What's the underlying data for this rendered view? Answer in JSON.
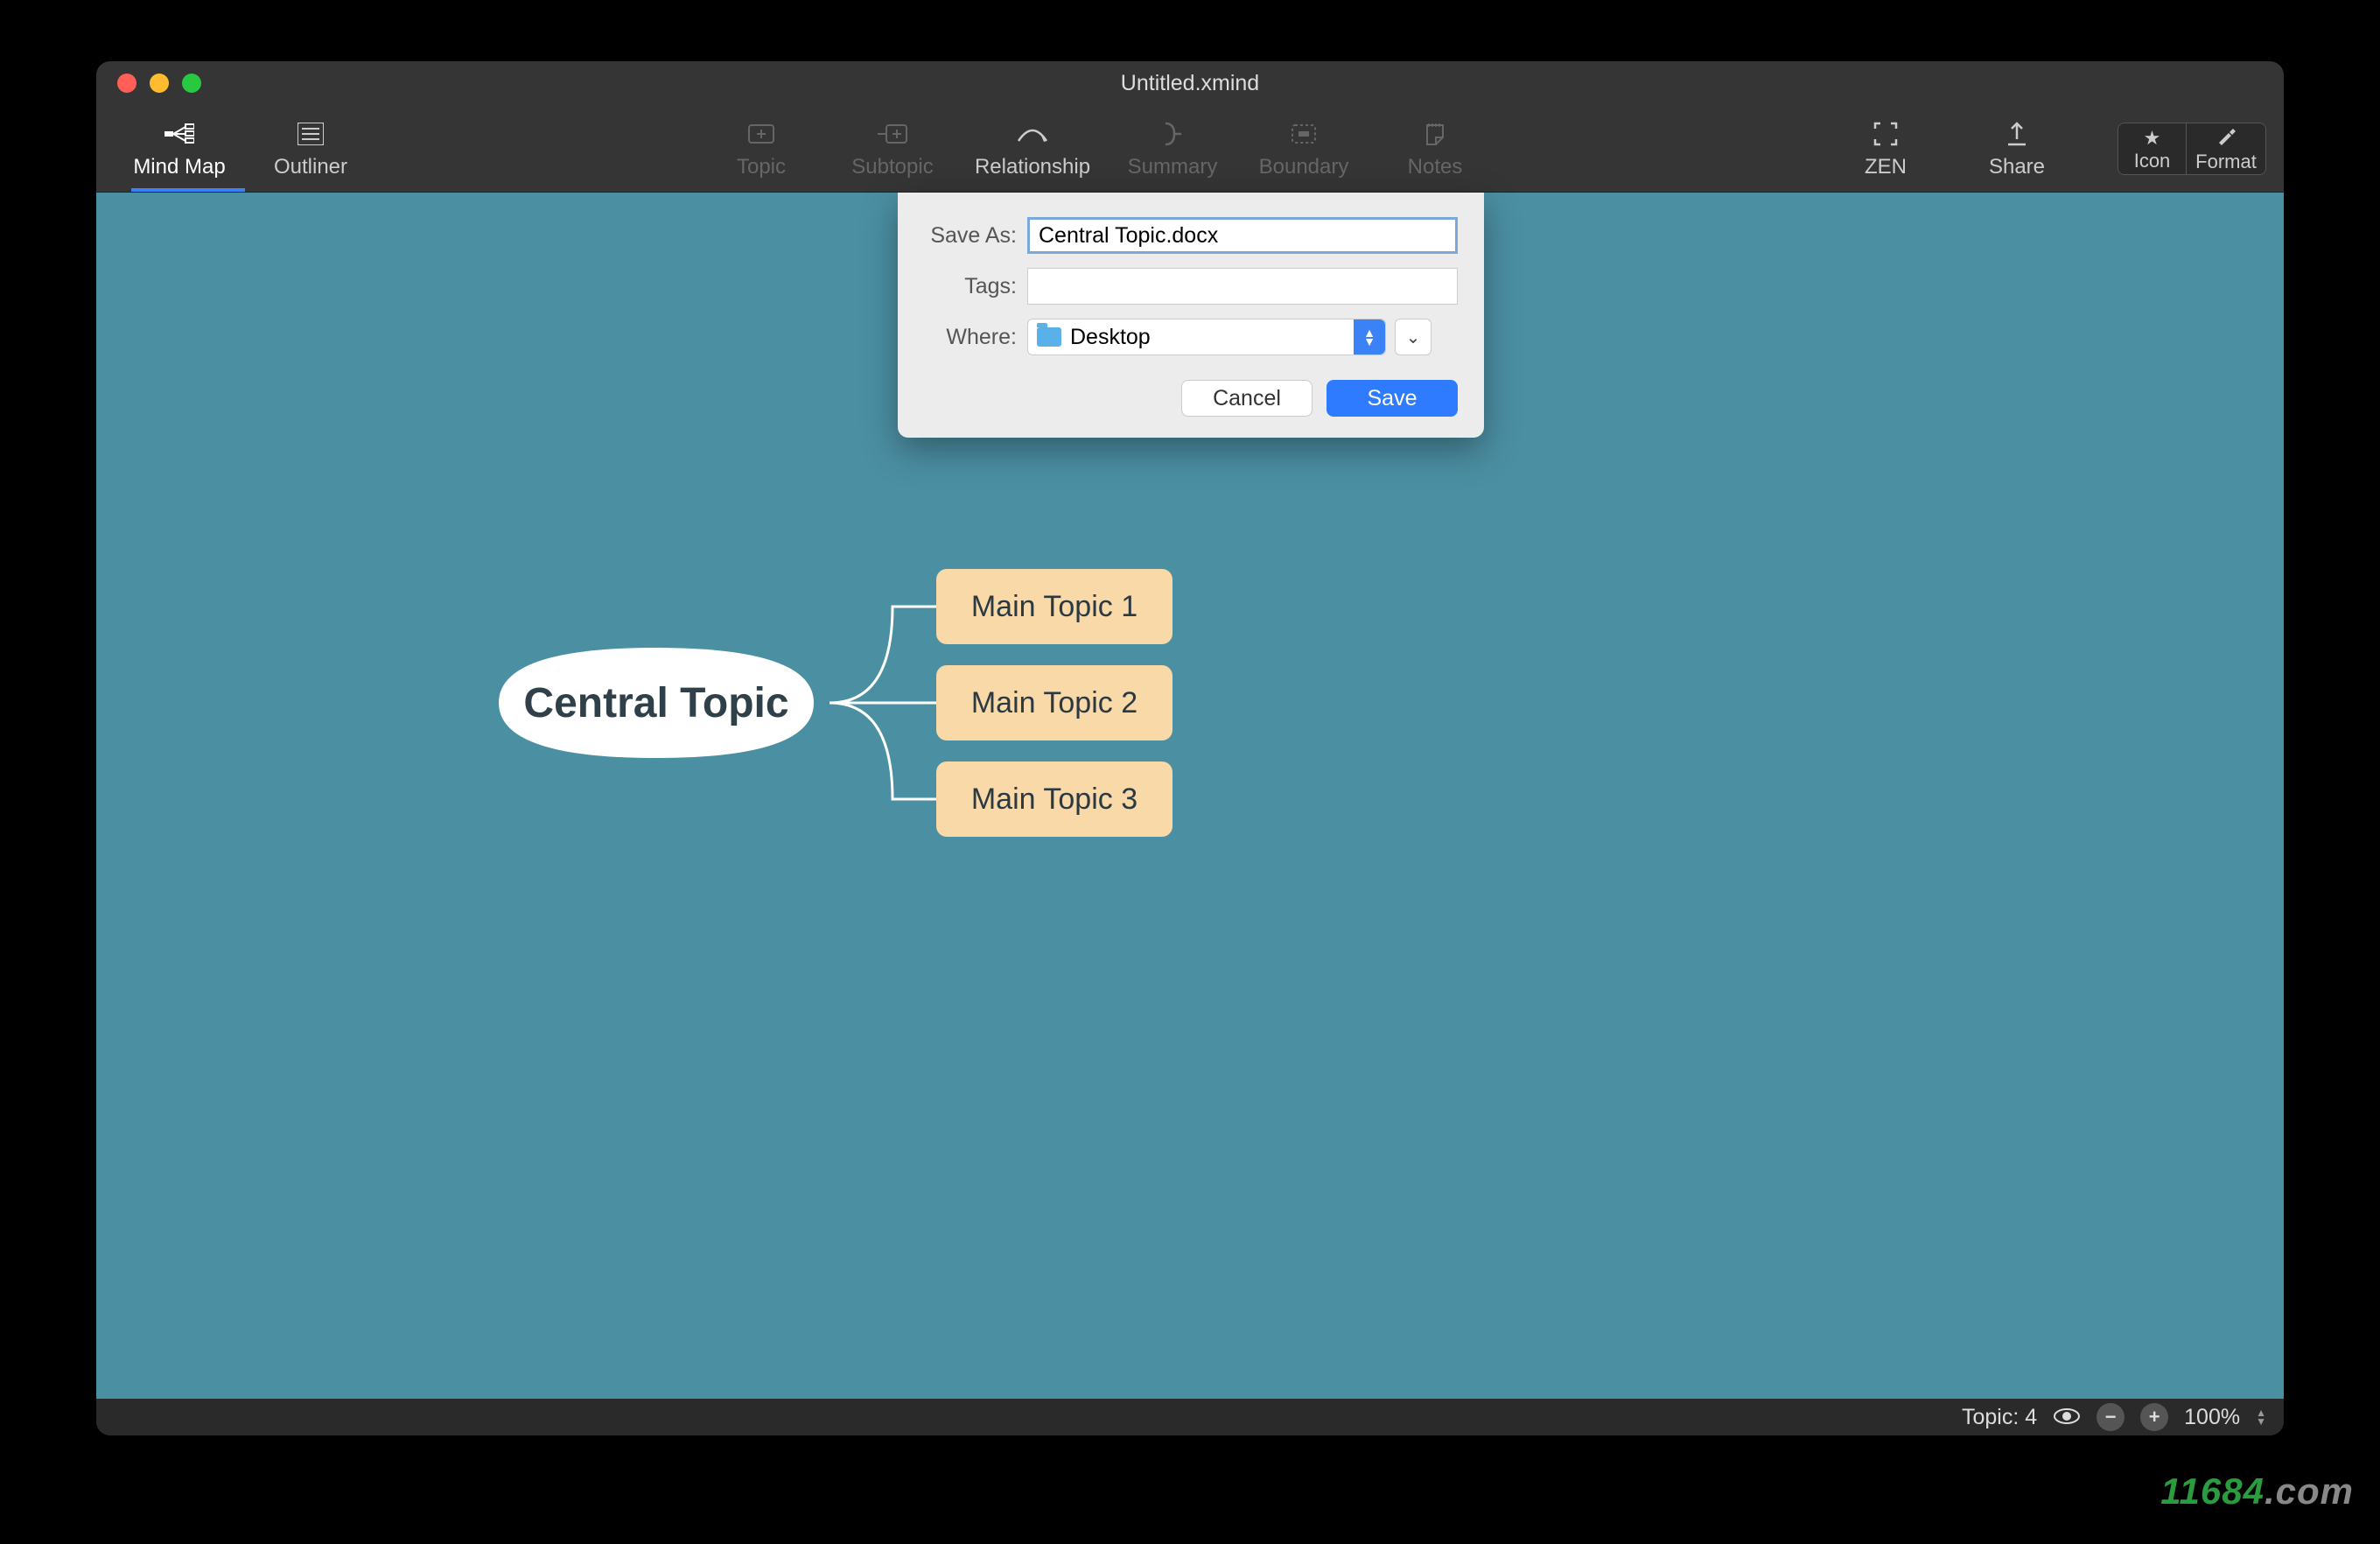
{
  "window": {
    "title": "Untitled.xmind"
  },
  "toolbar": {
    "left_tabs": [
      {
        "label": "Mind Map",
        "active": true
      },
      {
        "label": "Outliner",
        "active": false
      }
    ],
    "center_tools": [
      {
        "label": "Topic",
        "dimmed": true
      },
      {
        "label": "Subtopic",
        "dimmed": true
      },
      {
        "label": "Relationship",
        "dimmed": false
      },
      {
        "label": "Summary",
        "dimmed": true
      },
      {
        "label": "Boundary",
        "dimmed": true
      },
      {
        "label": "Notes",
        "dimmed": true
      }
    ],
    "right_tools": [
      {
        "label": "ZEN"
      },
      {
        "label": "Share"
      }
    ],
    "segmented": [
      {
        "label": "Icon"
      },
      {
        "label": "Format"
      }
    ]
  },
  "mindmap": {
    "central": "Central Topic",
    "topics": [
      "Main Topic 1",
      "Main Topic 2",
      "Main Topic 3"
    ]
  },
  "dialog": {
    "save_as_label": "Save As:",
    "save_as_value": "Central Topic.docx",
    "tags_label": "Tags:",
    "tags_value": "",
    "where_label": "Where:",
    "where_value": "Desktop",
    "cancel": "Cancel",
    "save": "Save"
  },
  "statusbar": {
    "topic_label": "Topic: 4",
    "zoom": "100%"
  },
  "watermark": {
    "text": "11684",
    "suffix": ".com"
  }
}
